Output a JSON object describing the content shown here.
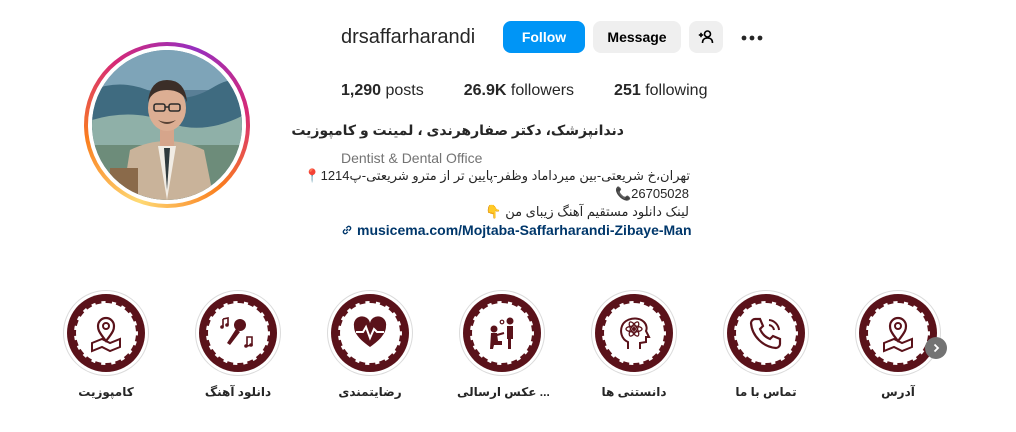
{
  "profile": {
    "username": "drsaffarharandi",
    "follow_label": "Follow",
    "message_label": "Message",
    "stats": {
      "posts_count": "1,290",
      "posts_label": "posts",
      "followers_count": "26.9K",
      "followers_label": "followers",
      "following_count": "251",
      "following_label": "following"
    },
    "full_name": "دندانپزشک، دکتر صفارهرندی ، لمینت و کامپوزیت",
    "category": "Dentist & Dental Office",
    "bio": {
      "line1": "تهران،خ شریعتی-بین میرداماد وظفر-پایین تر از مترو شریعتی-پ1214",
      "line2": "26705028",
      "line3": "لینک دانلود مستقیم آهنگ زیبای من"
    },
    "link": "musicema.com/Mojtaba-Saffarharandi-Zibaye-Man"
  },
  "highlights": [
    {
      "label": "کامپوزیت",
      "icon": "map-pin-icon"
    },
    {
      "label": "دانلود آهنگ",
      "icon": "microphone-music-icon"
    },
    {
      "label": "رضایتمندی",
      "icon": "heart-pulse-icon"
    },
    {
      "label": "عکس ارسالی ...",
      "icon": "proposal-icon"
    },
    {
      "label": "دانستنی ها",
      "icon": "brain-head-icon"
    },
    {
      "label": "تماس با ما",
      "icon": "phone-icon"
    },
    {
      "label": "آدرس",
      "icon": "map-pin-icon"
    }
  ],
  "colors": {
    "follow_button": "#0095f6",
    "secondary_button": "#efefef",
    "link": "#00376b",
    "highlight_disc": "#5a121a"
  }
}
